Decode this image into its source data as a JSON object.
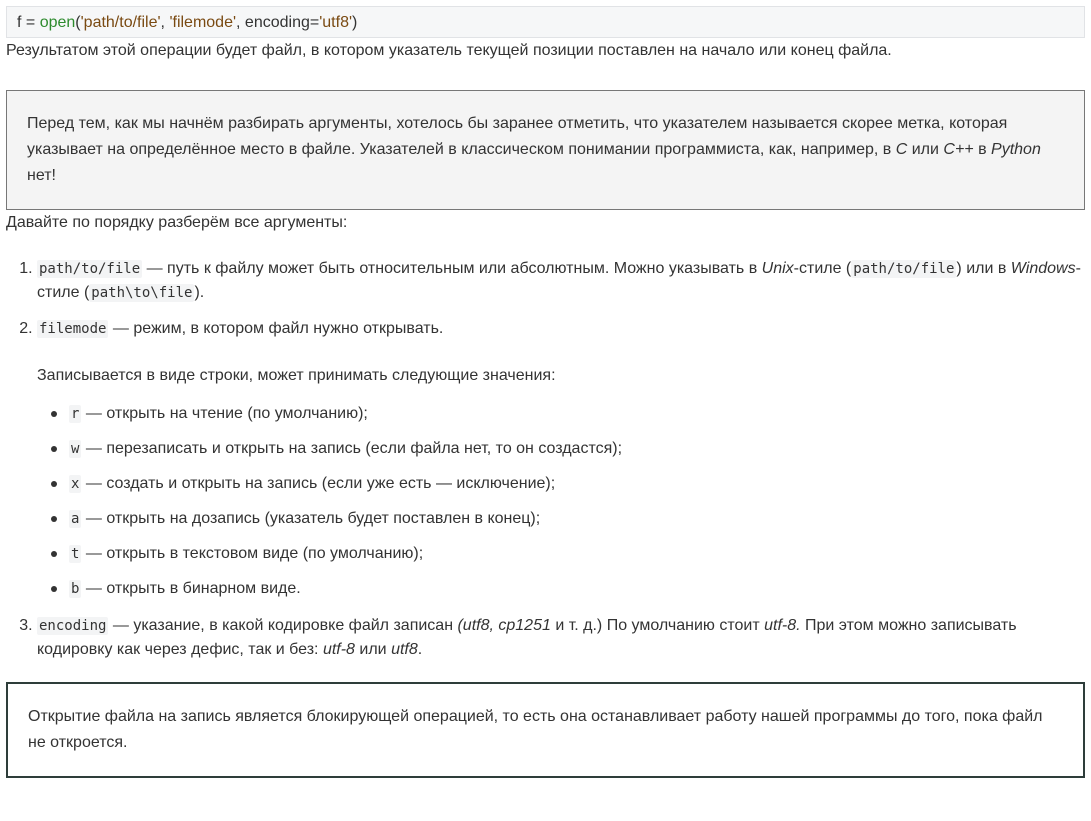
{
  "code": {
    "var": "f",
    "assign": " = ",
    "fn": "open",
    "open_paren": "(",
    "arg1": "'path/to/file'",
    "sep1": ", ",
    "arg2": "'filemode'",
    "sep2": ", encoding=",
    "arg3": "'utf8'",
    "close_paren": ")"
  },
  "intro": "Результатом этой операции будет файл, в котором указатель текущей позиции поставлен на начало или конец файла.",
  "note1": {
    "before": "Перед тем, как мы начнём разбирать аргументы, хотелось бы заранее отметить, что указателем называется скорее метка, которая указывает на определённое место в файле. Указателей в классическом понимании программиста, как, например, в ",
    "lang1": "C",
    "mid1": " или ",
    "lang2": "C++",
    "mid2": " в ",
    "lang3": "Python",
    "after": " нет!"
  },
  "lead": "Давайте по порядку разберём все аргументы:",
  "args": {
    "a1": {
      "code": "path/to/file",
      "text1": " — путь к файлу может быть относительным или абсолютным. Можно указывать в ",
      "em1": "Unix",
      "text2": "-стиле (",
      "code2": "path/to/file",
      "text3": ") или в ",
      "em2": "Windows",
      "text4": "-стиле (",
      "code3": "path\\to\\file",
      "text5": ")."
    },
    "a2": {
      "code": "filemode",
      "text1": " — режим, в котором файл нужно открывать.",
      "sub": "Записывается в виде строки, может принимать следующие значения:",
      "modes": [
        {
          "code": "r",
          "desc": " — открыть на чтение (по умолчанию);"
        },
        {
          "code": "w",
          "desc": " — перезаписать и открыть на запись (если файла нет, то он создастся);"
        },
        {
          "code": "x",
          "desc": " — создать и открыть на запись (если уже есть — исключение);"
        },
        {
          "code": "a",
          "desc": " — открыть на дозапись (указатель будет поставлен в конец);"
        },
        {
          "code": "t",
          "desc": " — открыть в текстовом виде (по умолчанию);"
        },
        {
          "code": "b",
          "desc": " — открыть в бинарном виде."
        }
      ]
    },
    "a3": {
      "code": "encoding",
      "text1": " — указание, в какой кодировке файл записан ",
      "em1": "(utf8, cp1251",
      "text2": " и т. д.) По умолчанию стоит ",
      "em2": "utf-8.",
      "text3": " При этом можно записывать кодировку как через дефис, так и без: ",
      "em3": "utf-8",
      "text4": " или ",
      "em4": "utf8",
      "text5": "."
    }
  },
  "note2": "Открытие файла на запись является блокирующей операцией, то есть она останавливает работу нашей программы до того, пока файл не откроется."
}
